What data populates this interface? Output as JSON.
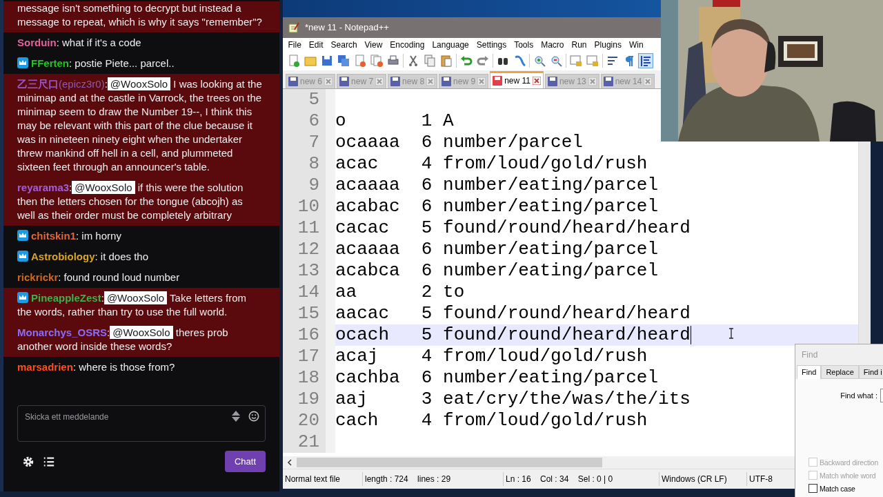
{
  "chat": {
    "messages": [
      {
        "text": "message isn't something to decrypt but instead a message to repeat, which is why it says \"remember\"?",
        "highlighted": true
      },
      {
        "author": "Sorduin",
        "color": "#e8609c",
        "badge": false,
        "separator": ":",
        "text": "what if it's a code",
        "highlighted": false
      },
      {
        "author": "FFerten",
        "color": "#22c322",
        "badge": true,
        "separator": ":",
        "text": "postie Piete... parcel..",
        "highlighted": false
      },
      {
        "author": "乙三尺口",
        "author_alt": "(epicz3r0)",
        "color": "#9a58d0",
        "badge": false,
        "separator": ":",
        "mention": "@WooxSolo",
        "text": "I was looking at the minimap and at the castle in Varrock, the trees on the minimap seem to draw the Number 19--, I think this may be relevant with this part of the clue because it was in nineteen ninety eight when the undertaker threw mankind off hell in a cell, and plummeted sixteen feet through an announcer's table.",
        "highlighted": true
      },
      {
        "author": "reyarama3",
        "color": "#a45fd8",
        "badge": false,
        "separator": ":",
        "mention": "@WooxSolo",
        "text": "if this were the solution then the letters chosen for the tongue (abcojh) as well as their order must be completely arbitrary",
        "highlighted": true
      },
      {
        "author": "chitskin1",
        "color": "#e0653a",
        "badge": true,
        "separator": ":",
        "text": "im horny",
        "highlighted": false
      },
      {
        "author": "Astrobiology",
        "color": "#daa520",
        "badge": true,
        "separator": ":",
        "text": "it does tho",
        "highlighted": false
      },
      {
        "author": "rickrickr",
        "color": "#d2691e",
        "badge": false,
        "separator": ":",
        "text": "found round loud number",
        "highlighted": false
      },
      {
        "author": "PineappleZest",
        "color": "#3cb34a",
        "badge": true,
        "separator": ":",
        "mention": "@WooxSolo",
        "text": "Take letters from the words, rather than try to use the full world.",
        "highlighted": true
      },
      {
        "author": "Monarchys_OSRS",
        "color": "#8a6cff",
        "badge": false,
        "separator": ":",
        "mention": "@WooxSolo",
        "text": "theres prob another word inside these words?",
        "highlighted": true
      },
      {
        "author": "marsadrien",
        "color": "#ff4f1f",
        "badge": false,
        "separator": ":",
        "text": "where is those from?",
        "highlighted": false
      }
    ],
    "input": {
      "placeholder": "Skicka ett meddelande"
    },
    "send_button": "Chatt"
  },
  "notepad": {
    "title": "*new 11 - Notepad++",
    "menu": [
      "File",
      "Edit",
      "Search",
      "View",
      "Encoding",
      "Language",
      "Settings",
      "Tools",
      "Macro",
      "Run",
      "Plugins",
      "Win"
    ],
    "tabs": [
      {
        "label": "new 6",
        "selected": false,
        "unsaved": false
      },
      {
        "label": "new 7",
        "selected": false,
        "unsaved": false
      },
      {
        "label": "new 8",
        "selected": false,
        "unsaved": false
      },
      {
        "label": "new 9",
        "selected": false,
        "unsaved": false
      },
      {
        "label": "new 11",
        "selected": true,
        "unsaved": true
      },
      {
        "label": "new 13",
        "selected": false,
        "unsaved": false
      },
      {
        "label": "new 14",
        "selected": false,
        "unsaved": false
      }
    ],
    "lines": [
      {
        "number": "5",
        "current": false
      },
      {
        "number": "6",
        "text": "o       1 A",
        "current": false
      },
      {
        "number": "7",
        "text": "ocaaaa  6 number/parcel",
        "current": false
      },
      {
        "number": "8",
        "text": "acac    4 from/loud/gold/rush",
        "current": false
      },
      {
        "number": "9",
        "text": "acaaaa  6 number/eating/parcel",
        "current": false
      },
      {
        "number": "10",
        "text": "acabac  6 number/eating/parcel",
        "current": false
      },
      {
        "number": "11",
        "text": "cacac   5 found/round/heard/heard",
        "current": false
      },
      {
        "number": "12",
        "text": "acaaaa  6 number/eating/parcel",
        "current": false
      },
      {
        "number": "13",
        "text": "acabca  6 number/eating/parcel",
        "current": false
      },
      {
        "number": "14",
        "text": "aa      2 to",
        "current": false
      },
      {
        "number": "15",
        "text": "aacac   5 found/round/heard/heard",
        "current": false
      },
      {
        "number": "16",
        "text": "ocach   5 found/round/heard/heard",
        "current": true
      },
      {
        "number": "17",
        "text": "acaj    4 from/loud/gold/rush",
        "current": false
      },
      {
        "number": "18",
        "text": "cachba  6 number/eating/parcel",
        "current": false
      },
      {
        "number": "19",
        "text": "aaj     3 eat/cry/the/was/the/its",
        "current": false
      },
      {
        "number": "20",
        "text": "cach    4 from/loud/gold/rush",
        "current": false
      },
      {
        "number": "21",
        "current": false
      }
    ],
    "status_bar": [
      "Normal text file",
      "length : 724    lines : 29",
      "Ln : 16    Col : 34    Sel : 0 | 0",
      "Windows (CR LF)",
      "UTF-8"
    ]
  },
  "find_dialog": {
    "title": "Find",
    "tabs": [
      {
        "label": "Find",
        "selected": true
      },
      {
        "label": "Replace",
        "selected": false
      },
      {
        "label": "Find i",
        "selected": false
      }
    ],
    "find_label": "Find what :",
    "options": [
      {
        "label": "Backward direction",
        "checked": false,
        "disabled": true
      },
      {
        "label": "Match whole word",
        "checked": false,
        "disabled": true
      },
      {
        "label": "Match case",
        "checked": false,
        "disabled": false
      }
    ]
  }
}
